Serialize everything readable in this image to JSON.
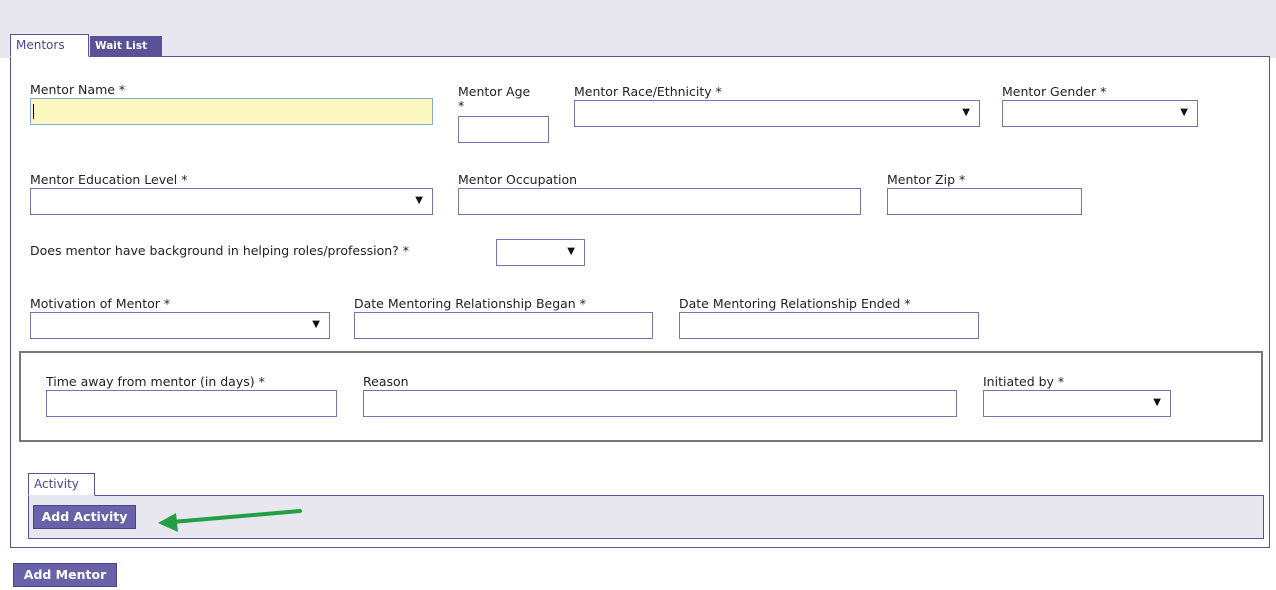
{
  "tabs": {
    "mentors": "Mentors",
    "wait_list": "Wait List"
  },
  "fields": {
    "mentor_name": {
      "label": "Mentor Name *",
      "value": ""
    },
    "mentor_age": {
      "label_line1": "Mentor Age",
      "label_line2": "*",
      "value": ""
    },
    "mentor_race": {
      "label": "Mentor Race/Ethnicity *",
      "value": ""
    },
    "mentor_gender": {
      "label": "Mentor Gender *",
      "value": ""
    },
    "mentor_education": {
      "label": "Mentor Education Level *",
      "value": ""
    },
    "mentor_occupation": {
      "label": "Mentor Occupation",
      "value": ""
    },
    "mentor_zip": {
      "label": "Mentor Zip *",
      "value": ""
    },
    "helping_background": {
      "label": "Does mentor have background in helping roles/profession? *",
      "value": ""
    },
    "motivation": {
      "label": "Motivation of Mentor *",
      "value": ""
    },
    "date_began": {
      "label": "Date Mentoring Relationship Began *",
      "value": ""
    },
    "date_ended": {
      "label": "Date Mentoring Relationship Ended *",
      "value": ""
    },
    "time_away": {
      "label": "Time away from mentor (in days) *",
      "value": ""
    },
    "reason": {
      "label": "Reason",
      "value": ""
    },
    "initiated_by": {
      "label": "Initiated by *",
      "value": ""
    }
  },
  "activity": {
    "tab_label": "Activity",
    "add_button": "Add Activity"
  },
  "add_mentor_button": "Add Mentor",
  "icons": {
    "dropdown_arrow": "▼",
    "annotation_arrow_color": "#22a043"
  },
  "colors": {
    "accent": "#5a5296",
    "button": "#6a62a8",
    "focused_input": "#fbf8c0",
    "band": "#e8e7f0"
  }
}
